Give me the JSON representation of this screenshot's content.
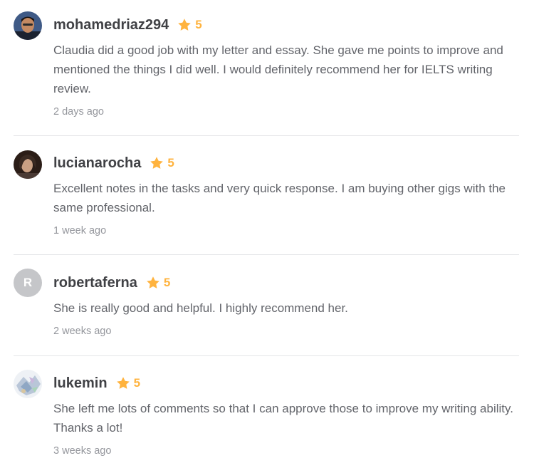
{
  "colors": {
    "star": "#ffb33e",
    "username": "#404145",
    "body": "#62646a",
    "muted": "#95979d",
    "divider": "#e4e5e7"
  },
  "reviews": [
    {
      "username": "mohamedriaz294",
      "rating": "5",
      "avatar": "photo",
      "text": "Claudia did a good job with my letter and essay. She gave me points to improve and mentioned the things I did well. I would definitely recommend her for IELTS writing review.",
      "time": "2 days ago"
    },
    {
      "username": "lucianarocha",
      "rating": "5",
      "avatar": "photo",
      "text": "Excellent notes in the tasks and very quick response. I am buying other gigs with the same professional.",
      "time": "1 week ago"
    },
    {
      "username": "robertaferna",
      "rating": "5",
      "avatar": "R",
      "text": "She is really good and helpful. I highly recommend her.",
      "time": "2 weeks ago"
    },
    {
      "username": "lukemin",
      "rating": "5",
      "avatar": "photo",
      "text": "She left me lots of comments so that I can approve those to improve my writing ability. Thanks a lot!",
      "time": "3 weeks ago"
    }
  ]
}
